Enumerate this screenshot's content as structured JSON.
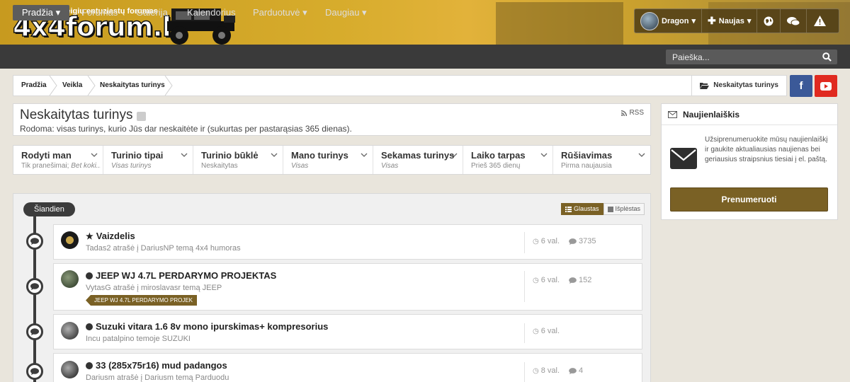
{
  "header": {
    "tagline": "Visureigių entuziastų forumas",
    "logo": "4x4forum.lt",
    "user_name": "Dragon",
    "new_label": "Naujas"
  },
  "nav": {
    "items": [
      {
        "label": "Pradžia",
        "dropdown": true,
        "active": true
      },
      {
        "label": "Forumas"
      },
      {
        "label": "Galerija"
      },
      {
        "label": "Kalendorius"
      },
      {
        "label": "Parduotuvė",
        "dropdown": true
      },
      {
        "label": "Daugiau",
        "dropdown": true
      }
    ],
    "search_placeholder": "Paieška..."
  },
  "breadcrumb": {
    "items": [
      "Pradžia",
      "Veikla",
      "Neskaitytas turinys"
    ],
    "current": "Neskaitytas turinys"
  },
  "page": {
    "title": "Neskaitytas turinys",
    "rss": "RSS",
    "description": "Rodoma: visas turinys, kurio Jūs dar neskaitėte ir (sukurtas per pastarąsias 365 dienas)."
  },
  "filters": [
    {
      "label": "Rodyti man",
      "value": "Tik pranešimai;",
      "value_extra": "Bet koki..."
    },
    {
      "label": "Turinio tipai",
      "value": "Visas turinys",
      "italic": true
    },
    {
      "label": "Turinio būklė",
      "value": "Neskaitytas"
    },
    {
      "label": "Mano turinys",
      "value": "Visas",
      "italic": true
    },
    {
      "label": "Sekamas turinys",
      "value": "Visas",
      "italic": true
    },
    {
      "label": "Laiko tarpas",
      "value": "Prieš 365 dienų"
    },
    {
      "label": "Rūšiavimas",
      "value": "Pirma naujausia"
    }
  ],
  "activity": {
    "group_label": "Šiandien",
    "view_compact": "Glaustas",
    "view_expanded": "Išplėstas",
    "items": [
      {
        "title": "Vaizdelis",
        "meta": "Tadas2 atrašė į DariusNP temą 4x4 humoras",
        "time": "6 val.",
        "replies": "3735",
        "marker": "star"
      },
      {
        "title": "JEEP WJ 4.7L PERDARYMO PROJEKTAS",
        "meta": "VytasG atrašė į miroslavasr temą JEEP",
        "time": "6 val.",
        "replies": "152",
        "tag": "JEEP WJ 4.7L PERDARYMO PROJEK",
        "marker": "dot"
      },
      {
        "title": "Suzuki vitara 1.6 8v mono ipurskimas+ kompresorius",
        "meta": "Incu patalpino temoje SUZUKI",
        "time": "6 val.",
        "marker": "dot"
      },
      {
        "title": "33 (285x75r16) mud padangos",
        "meta": "Dariusm atrašė į Dariusm temą Parduodu",
        "time": "8 val.",
        "replies": "4",
        "marker": "dot"
      }
    ]
  },
  "newsletter": {
    "title": "Naujienlaiškis",
    "text": "Užsiprenumeruokite mūsų naujienlaiškį ir gaukite aktualiausias naujienas bei geriausius straipsnius tiesiai į el. paštą.",
    "button": "Prenumeruoti"
  },
  "colors": {
    "accent": "#7a6125",
    "nav_bg": "#3a3a3a",
    "facebook": "#3b5998",
    "youtube": "#e02a20"
  }
}
